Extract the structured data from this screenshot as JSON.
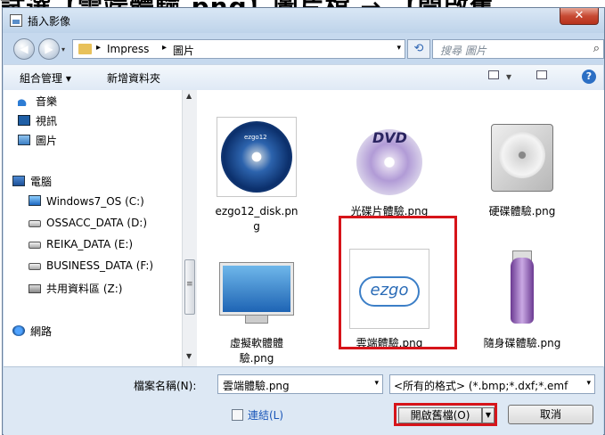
{
  "caption": "試選【雲端體驗.png】圖片檔 → 【開啟舊",
  "window": {
    "title": "插入影像",
    "close_glyph": "✕"
  },
  "address": {
    "back_glyph": "◀",
    "forward_glyph": "▶",
    "history_glyph": "▾",
    "crumbs": [
      "Impress",
      "圖片"
    ],
    "sep_glyph": "▸",
    "dropdown_glyph": "▾",
    "refresh_glyph": "⟲",
    "search_placeholder": "搜尋 圖片",
    "search_glyph": "⌕"
  },
  "toolbar": {
    "organize": "組合管理 ▾",
    "new_folder": "新增資料夾",
    "views_glyph": "▾",
    "help_glyph": "?"
  },
  "nav": {
    "items": [
      {
        "label": "音樂",
        "icon": "music-icon"
      },
      {
        "label": "視訊",
        "icon": "video-icon"
      },
      {
        "label": "圖片",
        "icon": "pictures-icon"
      },
      {
        "label": "電腦",
        "icon": "computer-icon"
      },
      {
        "label": "Windows7_OS (C:)",
        "icon": "os-drive-icon"
      },
      {
        "label": "OSSACC_DATA (D:)",
        "icon": "drive-icon"
      },
      {
        "label": "REIKA_DATA (E:)",
        "icon": "drive-icon"
      },
      {
        "label": "BUSINESS_DATA (F:)",
        "icon": "drive-icon"
      },
      {
        "label": "共用資料區 (Z:)",
        "icon": "network-drive-icon"
      },
      {
        "label": "網路",
        "icon": "network-icon"
      }
    ],
    "scroll_up_glyph": "▲",
    "scroll_down_glyph": "▼",
    "thumb_grip": "≡"
  },
  "files": [
    {
      "name": "ezgo12_disk.png",
      "thumb_text": "ezgo12"
    },
    {
      "name": "光碟片體驗.png",
      "thumb_text": "DVD"
    },
    {
      "name": "硬碟體驗.png",
      "thumb_text": ""
    },
    {
      "name": "虛擬軟體體驗.png",
      "thumb_text": ""
    },
    {
      "name": "雲端體驗.png",
      "thumb_text": "ezgo",
      "highlighted": true
    },
    {
      "name": "隨身碟體驗.png",
      "thumb_text": ""
    }
  ],
  "bottom": {
    "filename_label": "檔案名稱(N):",
    "filename_value": "雲端體驗.png",
    "filename_dropdown_glyph": "▾",
    "filter_value": "<所有的格式> (*.bmp;*.dxf;*.emf",
    "filter_dropdown_glyph": "▾",
    "link_label": "連結(L)",
    "open_label": "開啟舊檔(O)",
    "open_split_glyph": "▼",
    "cancel_label": "取消"
  },
  "colors": {
    "highlight": "#d6141a",
    "titlebar": "#c6d9ee",
    "close": "#c74a33",
    "link": "#1a56b8"
  }
}
